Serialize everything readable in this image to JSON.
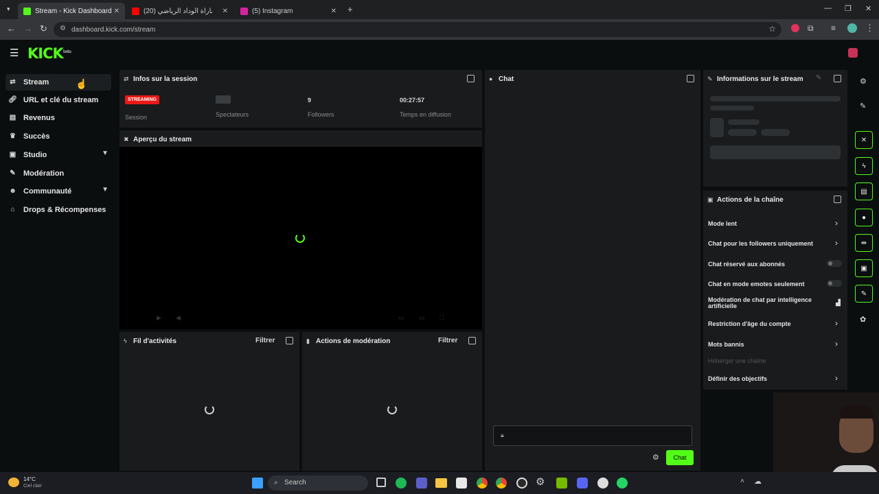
{
  "browser": {
    "tabs": [
      {
        "title": "Stream - Kick Dashboard",
        "active": true
      },
      {
        "title": "(20) مباشر مباراة الوداد الرياضي",
        "active": false
      },
      {
        "title": "(5) Instagram",
        "active": false
      }
    ],
    "url": "dashboard.kick.com/stream"
  },
  "sidebar": {
    "items": [
      {
        "label": "Stream",
        "icon": "stream-icon"
      },
      {
        "label": "URL et clé du stream",
        "icon": "link-icon"
      },
      {
        "label": "Revenus",
        "icon": "revenue-icon"
      },
      {
        "label": "Succès",
        "icon": "trophy-icon"
      },
      {
        "label": "Studio",
        "icon": "studio-icon"
      },
      {
        "label": "Modération",
        "icon": "wrench-icon"
      },
      {
        "label": "Communauté",
        "icon": "community-icon"
      },
      {
        "label": "Drops & Récompenses",
        "icon": "gift-icon"
      }
    ]
  },
  "session": {
    "title": "Infos sur la session",
    "badge": "STREAMING",
    "session_label": "Session",
    "viewers_label": "Spectateurs",
    "followers_value": "9",
    "followers_label": "Followers",
    "time_value": "00:27:57",
    "time_label": "Temps en diffusion"
  },
  "preview": {
    "title": "Aperçu du stream"
  },
  "activity": {
    "title": "Fil d'activités",
    "filter": "Filtrer"
  },
  "modactions": {
    "title": "Actions de modération",
    "filter": "Filtrer"
  },
  "chat": {
    "title": "Chat",
    "send_label": "Chat"
  },
  "streaminfo": {
    "title": "Informations sur le stream"
  },
  "channel_actions": {
    "title": "Actions de la chaîne",
    "items": [
      "Mode lent",
      "Chat pour les followers uniquement",
      "Chat réservé aux abonnés",
      "Chat en mode emotes seulement",
      "Modération de chat par intelligence artificielle",
      "Restriction d'âge du compte",
      "Mots bannis",
      "Héberger une chaîne",
      "Définir des objectifs"
    ]
  },
  "taskbar": {
    "weather_temp": "14°C",
    "weather_desc": "Ciel clair",
    "search": "Search"
  },
  "colors": {
    "accent": "#53fc18",
    "streaming_badge": "#e91916"
  }
}
